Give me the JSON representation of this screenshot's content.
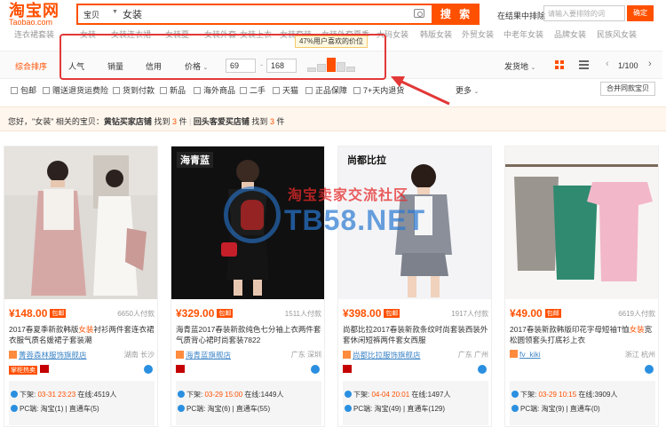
{
  "header": {
    "logo_cn": "淘宝网",
    "logo_en": "Taobao.com",
    "search_category": "宝贝",
    "search_query": "女装",
    "search_button": "搜 索",
    "exclude_label": "在结果中排除",
    "exclude_placeholder": "请输入要排除的词",
    "confirm_button": "确定"
  },
  "categories": [
    "连衣裙套装",
    "女装",
    "女装连衣裙",
    "女装夏",
    "女装外套",
    "女装上衣",
    "女装套装",
    "女装外套夏季",
    "大码女装",
    "韩版女装",
    "外贸女装",
    "中老年女装",
    "品牌女装",
    "民族风女装"
  ],
  "sort_bar": {
    "items": [
      "综合排序",
      "人气",
      "销量",
      "信用",
      "价格"
    ],
    "price_min": "69",
    "price_max": "168",
    "price_tooltip": "47%用户喜欢的价位",
    "ship_from": "发货地",
    "page_info": "1/100"
  },
  "filters": [
    "包邮",
    "赠送退货运费险",
    "货到付款",
    "新品",
    "海外商品",
    "二手",
    "天猫",
    "正品保障",
    "7+天内退货"
  ],
  "more_label": "更多",
  "merge_button": "合并同款宝贝",
  "notice": {
    "prefix": "您好，\"女装\" 相关的宝贝：",
    "gold_label": "黄钻买家店铺",
    "found": "找到",
    "gold_count": "3",
    "unit": "件",
    "divider": "|",
    "repeat_label": "回头客爱买店铺",
    "repeat_count": "3"
  },
  "products": [
    {
      "price": "¥148.00",
      "baoyou": "包邮",
      "sold": "6650人付款",
      "title_pre": "2017春夏季新款韩版",
      "title_hl": "女装",
      "title_post": "衬衫两件套连衣裙衣服气质名媛裙子套装潮",
      "shop": "菁蓉森林服饰旗舰店",
      "location": "湖南 长沙",
      "badge": "掌柜热卖",
      "stat1_pre": "下架:",
      "stat1_time": "03-31 23:23",
      "stat1_mid": "在线:",
      "stat1_count": "4519人",
      "stat2_pre": "PC端:",
      "stat2_src": "淘宝(1)",
      "stat2_mid": "直通车(5)"
    },
    {
      "price": "¥329.00",
      "baoyou": "包邮",
      "sold": "1511人付款",
      "title_pre": "海青蓝2017春装新款纯色七分袖上衣两件套气质背心裙时尚套装7822",
      "title_hl": "",
      "title_post": "",
      "shop": "海青蓝旗舰店",
      "location": "广东 深圳",
      "badge": "",
      "stat1_pre": "下架:",
      "stat1_time": "03-29 15:00",
      "stat1_mid": "在线:",
      "stat1_count": "1449人",
      "stat2_pre": "PC端:",
      "stat2_src": "淘宝(6)",
      "stat2_mid": "直通车(55)"
    },
    {
      "price": "¥398.00",
      "baoyou": "包邮",
      "sold": "1917人付款",
      "title_pre": "尚都比拉2017春装新款条纹时尚套装西装外套休闲短裤两件套女西服",
      "title_hl": "",
      "title_post": "",
      "shop": "尚都比拉服饰旗舰店",
      "location": "广东 广州",
      "badge": "",
      "stat1_pre": "下架:",
      "stat1_time": "04-04 20:01",
      "stat1_mid": "在线:",
      "stat1_count": "1497人",
      "stat2_pre": "PC端:",
      "stat2_src": "淘宝(49)",
      "stat2_mid": "直通车(129)"
    },
    {
      "price": "¥49.00",
      "baoyou": "包邮",
      "sold": "6619人付款",
      "title_pre": "2017春装新款韩版印花字母短袖T恤",
      "title_hl": "女装",
      "title_post": "宽松圆领套头打底衫上衣",
      "shop": "fv_kiki",
      "location": "浙江 杭州",
      "badge": "",
      "stat1_pre": "下架:",
      "stat1_time": "03-29 10:15",
      "stat1_mid": "在线:",
      "stat1_count": "3909人",
      "stat2_pre": "PC端:",
      "stat2_src": "淘宝(9)",
      "stat2_mid": "直通车(0)"
    }
  ],
  "product_images": [
    {
      "brand": ""
    },
    {
      "brand": "海青蓝"
    },
    {
      "brand": "尚都比拉"
    },
    {
      "brand": ""
    }
  ],
  "watermark": {
    "cn": "淘宝卖家交流社区",
    "en": "TB58.NET"
  },
  "colors": {
    "accent": "#ff5000",
    "link": "#3f86c7",
    "highlight_border": "#e23838"
  }
}
